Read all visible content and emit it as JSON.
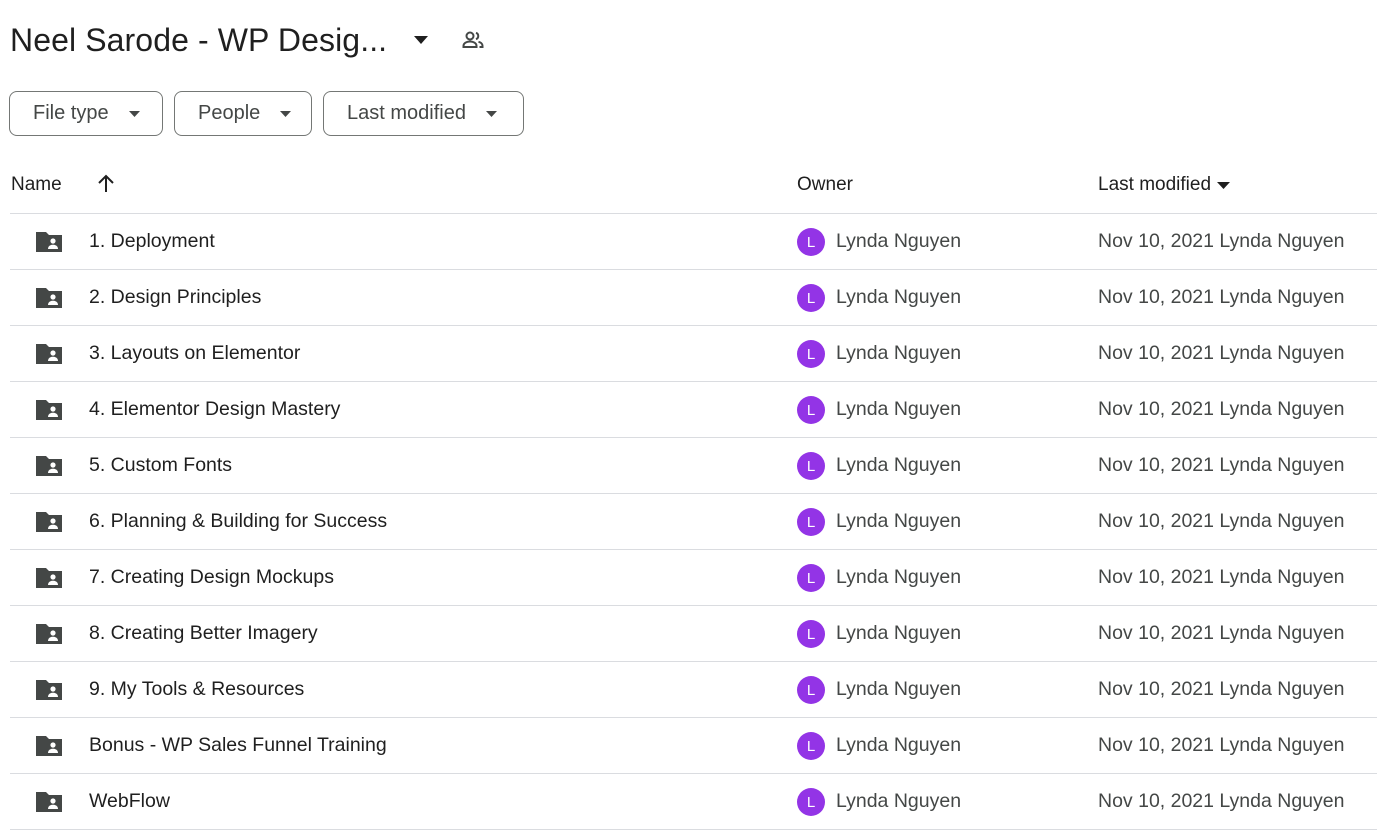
{
  "header": {
    "title": "Neel Sarode - WP Desig...",
    "dropdown_icon": "arrow-drop-down-icon",
    "shared_icon": "people-icon"
  },
  "filters": [
    {
      "label": "File type"
    },
    {
      "label": "People"
    },
    {
      "label": "Last modified"
    }
  ],
  "table": {
    "columns": {
      "name": "Name",
      "owner": "Owner",
      "modified": "Last modified"
    },
    "sort": {
      "name_sort_icon": "arrow-upward-icon",
      "modified_sort_icon": "arrow-drop-down-icon"
    },
    "rows": [
      {
        "name": "1. Deployment",
        "owner_initial": "L",
        "owner": "Lynda Nguyen",
        "modified": "Nov 10, 2021 Lynda Nguyen"
      },
      {
        "name": "2. Design Principles",
        "owner_initial": "L",
        "owner": "Lynda Nguyen",
        "modified": "Nov 10, 2021 Lynda Nguyen"
      },
      {
        "name": "3. Layouts on Elementor",
        "owner_initial": "L",
        "owner": "Lynda Nguyen",
        "modified": "Nov 10, 2021 Lynda Nguyen"
      },
      {
        "name": "4. Elementor Design Mastery",
        "owner_initial": "L",
        "owner": "Lynda Nguyen",
        "modified": "Nov 10, 2021 Lynda Nguyen"
      },
      {
        "name": "5. Custom Fonts",
        "owner_initial": "L",
        "owner": "Lynda Nguyen",
        "modified": "Nov 10, 2021 Lynda Nguyen"
      },
      {
        "name": "6. Planning & Building for Success",
        "owner_initial": "L",
        "owner": "Lynda Nguyen",
        "modified": "Nov 10, 2021 Lynda Nguyen"
      },
      {
        "name": "7. Creating Design Mockups",
        "owner_initial": "L",
        "owner": "Lynda Nguyen",
        "modified": "Nov 10, 2021 Lynda Nguyen"
      },
      {
        "name": "8. Creating Better Imagery",
        "owner_initial": "L",
        "owner": "Lynda Nguyen",
        "modified": "Nov 10, 2021 Lynda Nguyen"
      },
      {
        "name": "9. My Tools & Resources",
        "owner_initial": "L",
        "owner": "Lynda Nguyen",
        "modified": "Nov 10, 2021 Lynda Nguyen"
      },
      {
        "name": "Bonus - WP Sales Funnel Training",
        "owner_initial": "L",
        "owner": "Lynda Nguyen",
        "modified": "Nov 10, 2021 Lynda Nguyen"
      },
      {
        "name": "WebFlow",
        "owner_initial": "L",
        "owner": "Lynda Nguyen",
        "modified": "Nov 10, 2021 Lynda Nguyen"
      }
    ]
  },
  "colors": {
    "avatar": "#9334e6",
    "folder_icon": "#444746",
    "divider": "#dadce0"
  }
}
